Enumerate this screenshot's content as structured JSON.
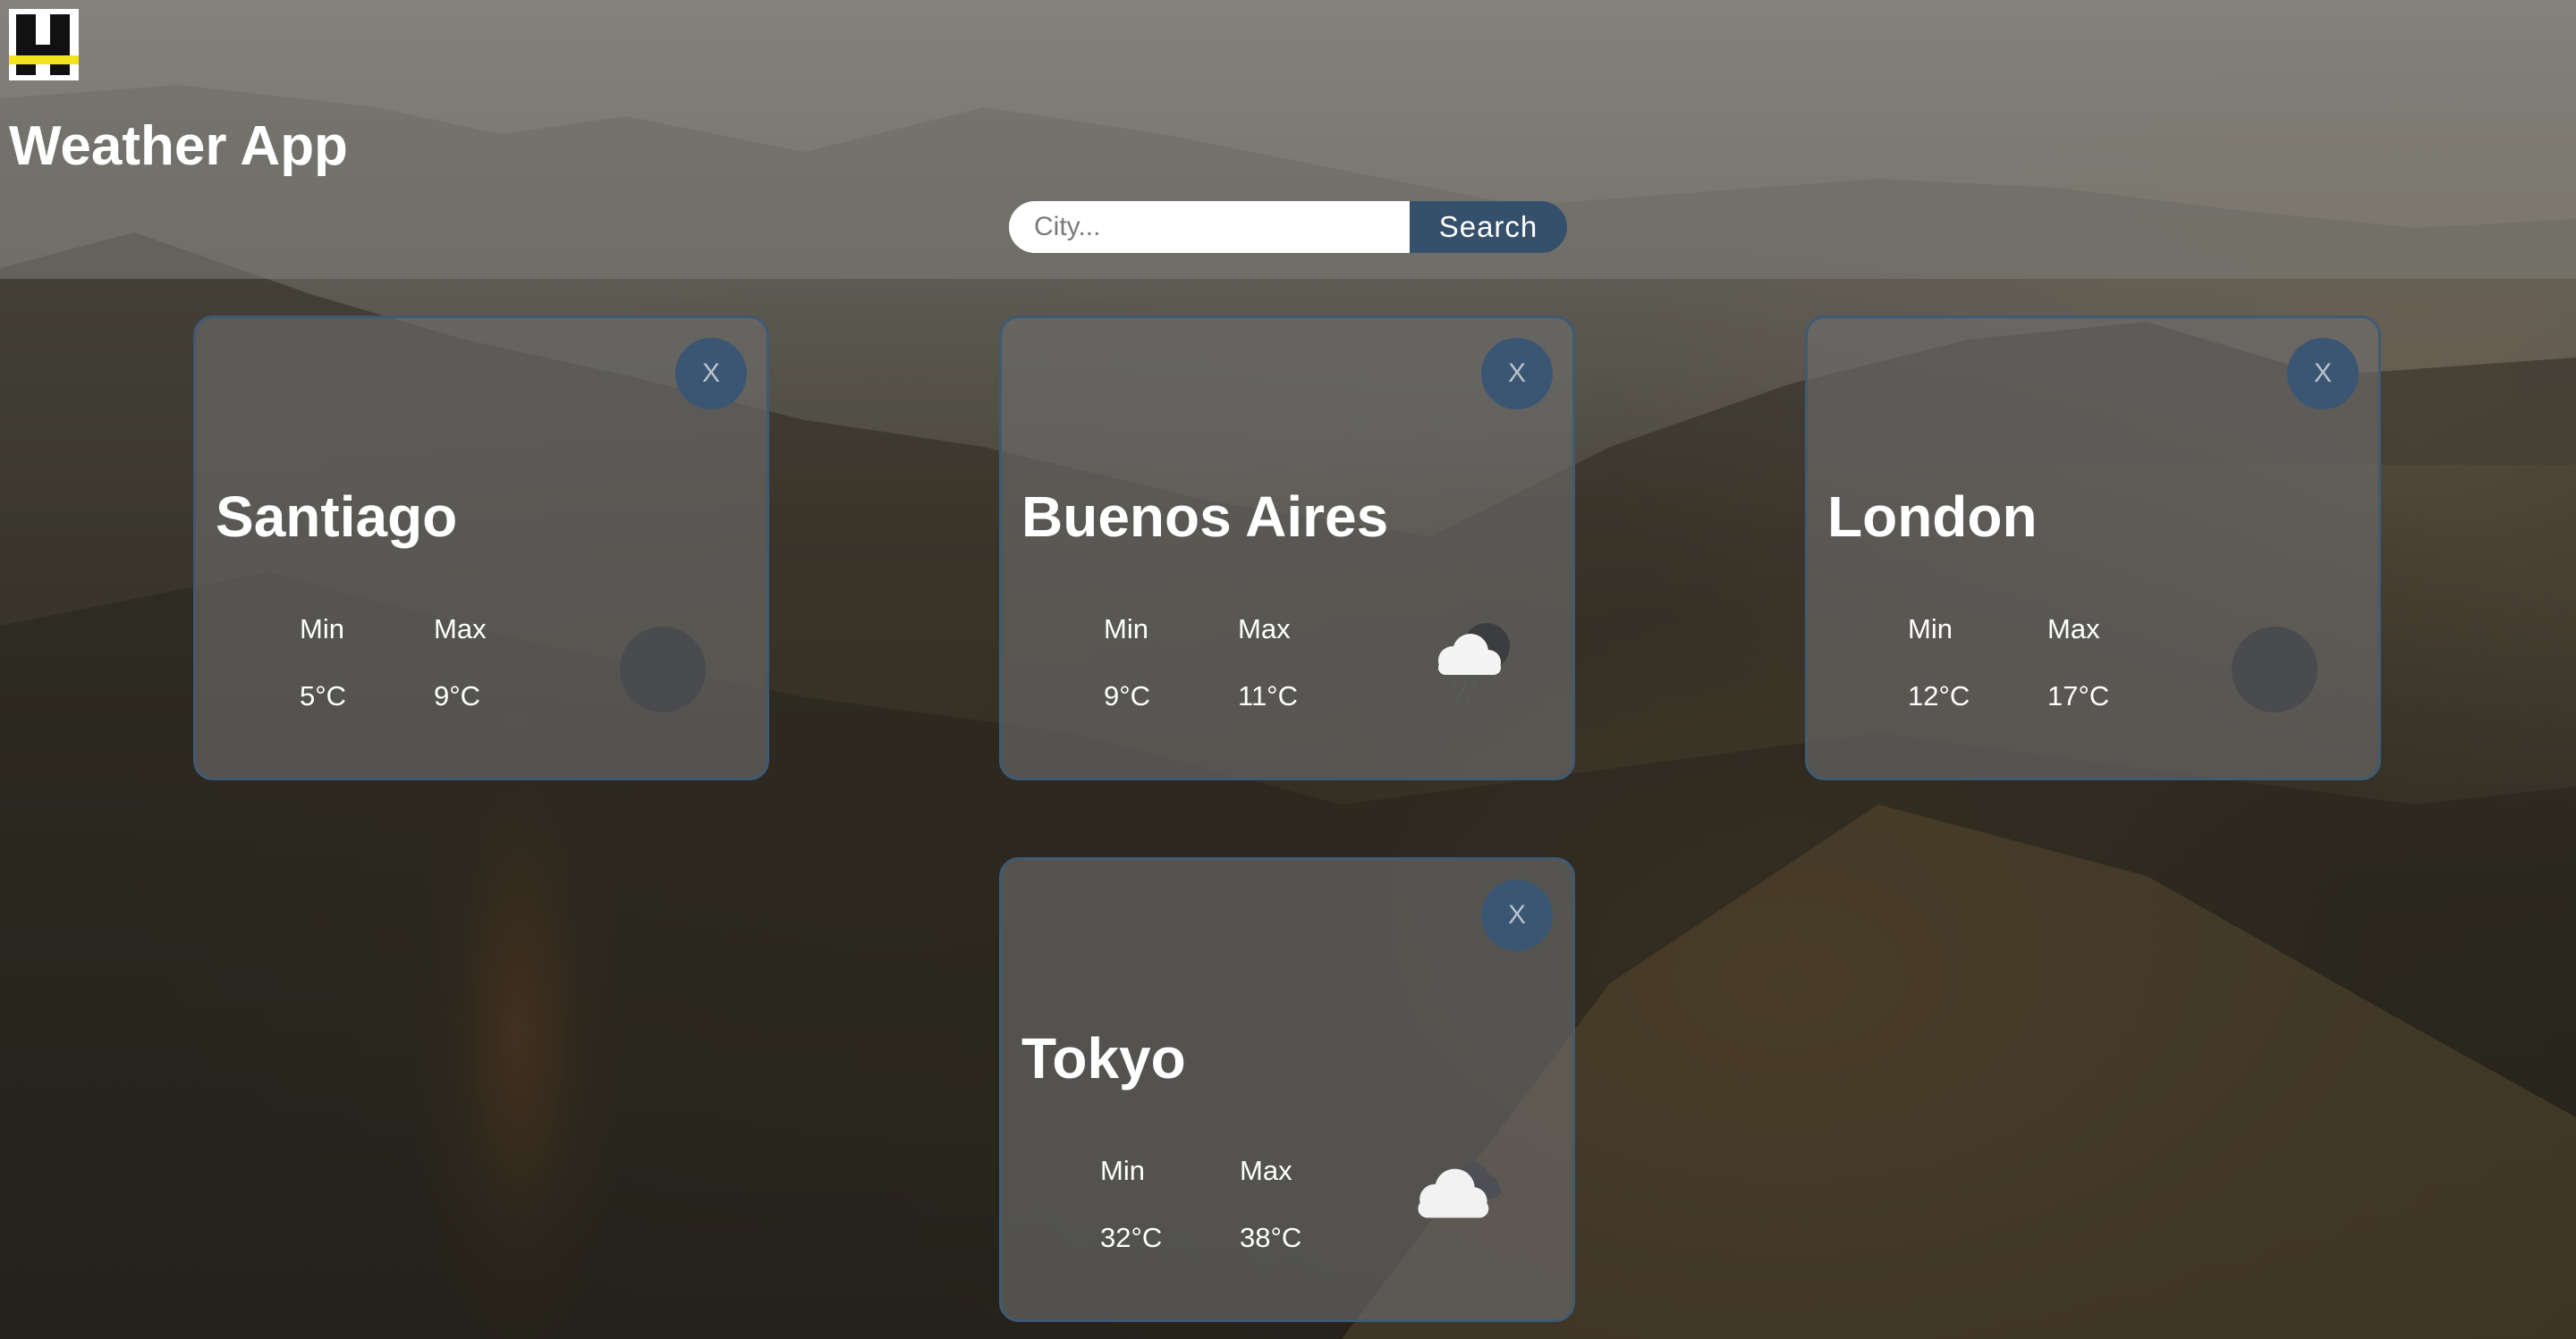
{
  "app": {
    "title": "Weather App"
  },
  "search": {
    "placeholder": "City...",
    "value": "",
    "button_label": "Search"
  },
  "cards": [
    {
      "city": "Santiago",
      "close_label": "X",
      "min_label": "Min",
      "max_label": "Max",
      "min_value": "5°C",
      "max_value": "9°C",
      "icon": "empty-icon-placeholder"
    },
    {
      "city": "Buenos Aires",
      "close_label": "X",
      "min_label": "Min",
      "max_label": "Max",
      "min_value": "9°C",
      "max_value": "11°C",
      "icon": "rain-cloud-icon"
    },
    {
      "city": "London",
      "close_label": "X",
      "min_label": "Min",
      "max_label": "Max",
      "min_value": "12°C",
      "max_value": "17°C",
      "icon": "empty-icon-placeholder"
    },
    {
      "city": "Tokyo",
      "close_label": "X",
      "min_label": "Min",
      "max_label": "Max",
      "min_value": "32°C",
      "max_value": "38°C",
      "icon": "cloudy-icon"
    }
  ],
  "colors": {
    "accent": "#35506b",
    "card_border": "#3f5a73",
    "logo_stripe": "#f2e51d"
  }
}
